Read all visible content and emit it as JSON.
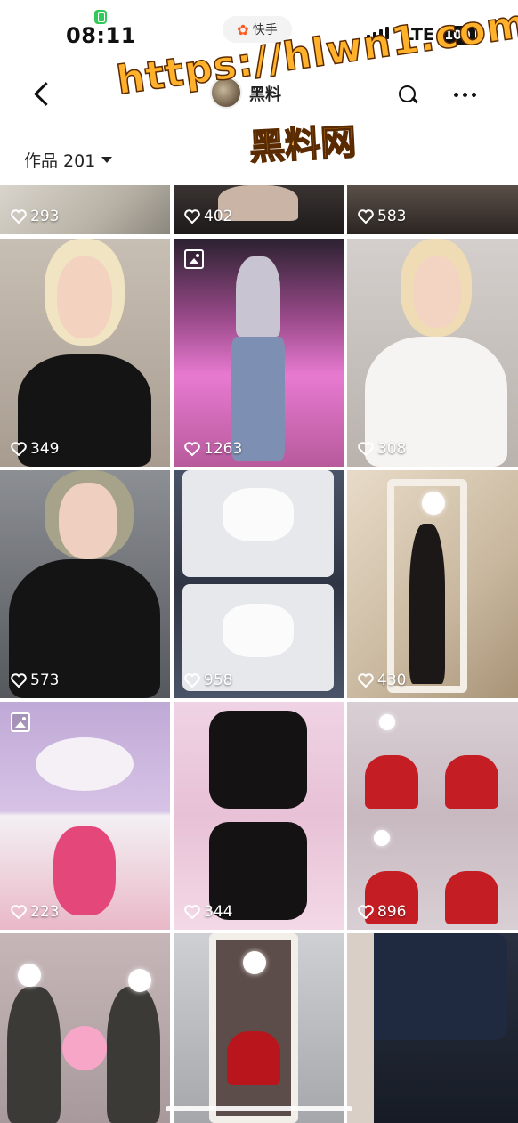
{
  "status": {
    "time": "08:11",
    "network": "LTE",
    "battery": "100",
    "app_pill_label": "快手",
    "app_pill_logo": "✿"
  },
  "nav": {
    "name": "黑料"
  },
  "watermark": {
    "line1": "https://hlwn1.com",
    "line2": "黑料网"
  },
  "tab": {
    "label": "作品 201"
  },
  "tiles": [
    {
      "likes": "293"
    },
    {
      "likes": "402"
    },
    {
      "likes": "583"
    },
    {
      "likes": "349"
    },
    {
      "likes": "1263"
    },
    {
      "likes": "308"
    },
    {
      "likes": "573"
    },
    {
      "likes": "958"
    },
    {
      "likes": "430"
    },
    {
      "likes": "223"
    },
    {
      "likes": "344"
    },
    {
      "likes": "896"
    }
  ],
  "icons": {
    "heart": "heart-icon",
    "photo": "photo-album-icon",
    "back": "back-arrow-icon",
    "search": "search-icon",
    "more": "more-dots-icon"
  }
}
